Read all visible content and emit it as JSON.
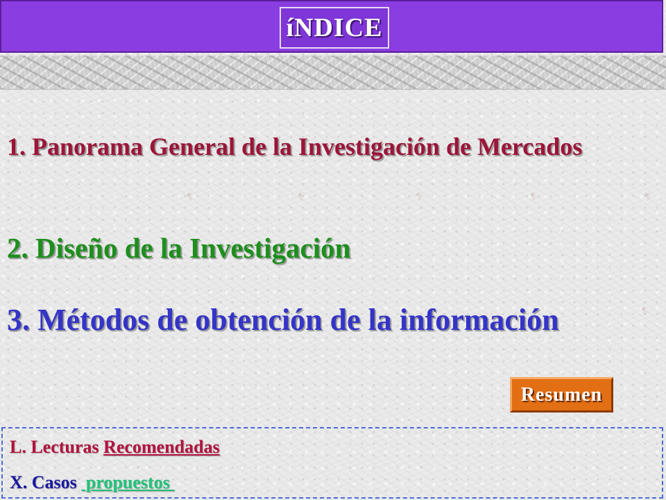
{
  "header": {
    "title": "íNDICE",
    "bar_color": "#8a3de0"
  },
  "menu": {
    "items": [
      {
        "label": "1. Panorama General de la Investigación de Mercados",
        "color": "#9c1538"
      },
      {
        "label": "2. Diseño de la Investigación",
        "color": "#1c8f1c"
      },
      {
        "label": "3. Métodos de obtención de la información",
        "color": "#3434c8"
      }
    ]
  },
  "resumen_button": {
    "label": "Resumen",
    "color": "#e36f14"
  },
  "links": {
    "lecturas": {
      "prefix": "L. Lecturas ",
      "link_label": "Recomendadas"
    },
    "casos": {
      "prefix": "X. Casos ",
      "link_label": " propuestos "
    }
  }
}
